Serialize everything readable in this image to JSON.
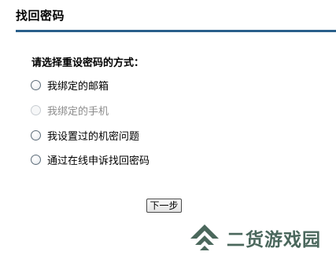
{
  "page": {
    "title": "找回密码"
  },
  "form": {
    "question": "请选择重设密码的方式：",
    "options": [
      {
        "label": "我绑定的邮箱",
        "enabled": true,
        "selected": false
      },
      {
        "label": "我绑定的手机",
        "enabled": false,
        "selected": false
      },
      {
        "label": "我设置过的机密问题",
        "enabled": true,
        "selected": false
      },
      {
        "label": "通过在线申诉找回密码",
        "enabled": true,
        "selected": false
      }
    ],
    "next_label": "下一步"
  },
  "watermark": {
    "text": "二货游戏园",
    "icon": "chevron-up-logo-icon",
    "color": "#2b4d40"
  },
  "colors": {
    "title_rule": "#2a5f8a"
  }
}
